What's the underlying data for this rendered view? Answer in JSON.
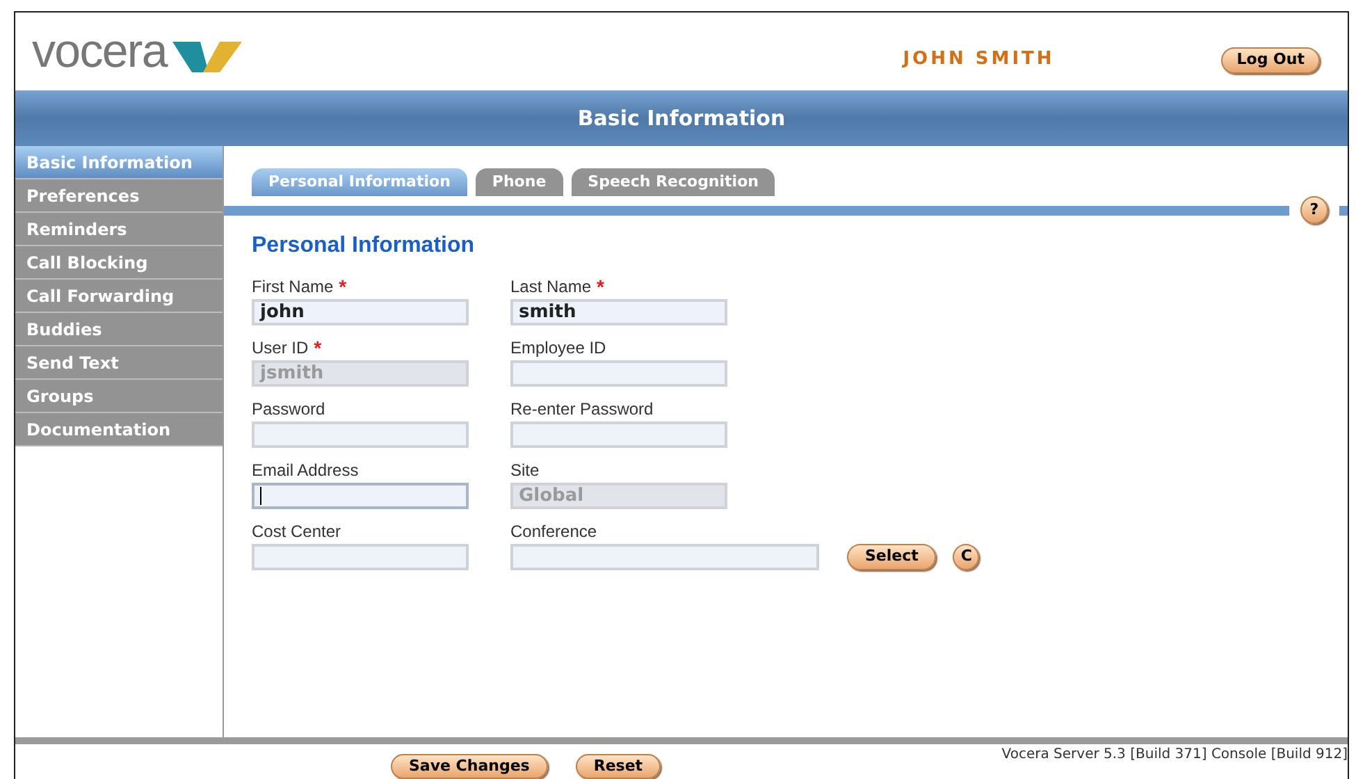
{
  "header": {
    "logo": "vocera",
    "user": "JOHN SMITH",
    "logout": "Log Out"
  },
  "title_bar": "Basic Information",
  "sidebar": {
    "items": [
      {
        "label": "Basic Information",
        "selected": true
      },
      {
        "label": "Preferences",
        "selected": false
      },
      {
        "label": "Reminders",
        "selected": false
      },
      {
        "label": "Call Blocking",
        "selected": false
      },
      {
        "label": "Call Forwarding",
        "selected": false
      },
      {
        "label": "Buddies",
        "selected": false
      },
      {
        "label": "Send Text",
        "selected": false
      },
      {
        "label": "Groups",
        "selected": false
      },
      {
        "label": "Documentation",
        "selected": false
      }
    ]
  },
  "tabs": [
    {
      "label": "Personal Information",
      "selected": true
    },
    {
      "label": "Phone",
      "selected": false
    },
    {
      "label": "Speech Recognition",
      "selected": false
    }
  ],
  "help": "?",
  "section_title": "Personal Information",
  "fields": [
    {
      "label": "First Name",
      "value": "john",
      "required": true,
      "disabled": false,
      "focused": false,
      "wide": false
    },
    {
      "label": "Last Name",
      "value": "smith",
      "required": true,
      "disabled": false,
      "focused": false,
      "wide": false
    },
    {
      "label": "User ID",
      "value": "jsmith",
      "required": true,
      "disabled": true,
      "focused": false,
      "wide": false
    },
    {
      "label": "Employee ID",
      "required": false,
      "disabled": false,
      "focused": false,
      "wide": false
    },
    {
      "label": "Password",
      "required": false,
      "disabled": false,
      "focused": false,
      "wide": false
    },
    {
      "label": "Re-enter Password",
      "required": false,
      "disabled": false,
      "focused": false,
      "wide": false
    },
    {
      "label": "Email Address",
      "required": false,
      "disabled": false,
      "focused": true,
      "wide": false
    },
    {
      "label": "Site",
      "value": "Global",
      "required": false,
      "disabled": true,
      "focused": false,
      "wide": false
    },
    {
      "label": "Cost Center",
      "required": false,
      "disabled": false,
      "focused": false,
      "wide": false
    },
    {
      "label": "Conference",
      "required": false,
      "disabled": false,
      "focused": false,
      "wide": true,
      "buttons": [
        {
          "label": "Select",
          "kind": "pill"
        },
        {
          "label": "C",
          "kind": "round"
        }
      ]
    }
  ],
  "required_mark": "*",
  "footer": {
    "buttons": [
      "Save Changes",
      "Reset"
    ],
    "version": "Vocera Server 5.3 [Build 371] Console [Build 912]"
  }
}
